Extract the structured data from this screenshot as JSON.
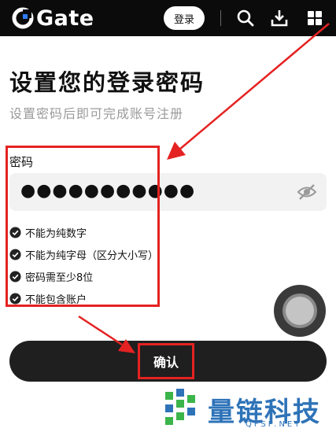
{
  "header": {
    "brand": "Gate",
    "login_label": "登录",
    "icons": [
      "search-icon",
      "download-icon",
      "grid-menu-icon"
    ]
  },
  "page": {
    "title": "设置您的登录密码",
    "subtitle": "设置密码后即可完成账号注册"
  },
  "form": {
    "password_label": "密码",
    "password_value": "●●●●●●●●●●●",
    "eye_icon": "eye-off-icon"
  },
  "rules": [
    {
      "text": "不能为纯数字",
      "status": "passed"
    },
    {
      "text": "不能为纯字母（区分大小写）",
      "status": "passed"
    },
    {
      "text": "密码需至少8位",
      "status": "passed"
    },
    {
      "text": "不能包含账户",
      "status": "passed"
    }
  ],
  "confirm": {
    "label": "确认"
  },
  "watermark": {
    "text": "量链科技",
    "sub": "QFSP.NET"
  },
  "colors": {
    "header_bg": "#0b0b0b",
    "highlight": "#e52222",
    "button_bg": "#1f1f1f",
    "watermark": "#2e73b8",
    "watermark_green": "#3bb54a"
  }
}
